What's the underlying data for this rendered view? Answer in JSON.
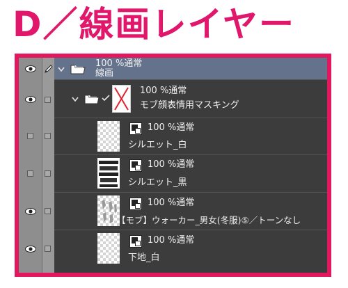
{
  "heading": "D／線画レイヤー",
  "layers": [
    {
      "opacity_blend": "100 %通常",
      "name": "線画"
    },
    {
      "opacity_blend": "100 %通常",
      "name": "モブ顔表情用マスキング"
    },
    {
      "opacity_blend": "100 %通常",
      "name": "シルエット_白"
    },
    {
      "opacity_blend": "100 %通常",
      "name": "シルエット_黒"
    },
    {
      "opacity_blend": "100 %通常",
      "name": "【モブ】ウォーカー_男女(冬服)⑤／トーンなし"
    },
    {
      "opacity_blend": "100 %通常",
      "name": "下地_白"
    }
  ],
  "colors": {
    "accent": "#e2175d",
    "heading": "#e0176a",
    "selected_row": "#64738b",
    "panel": "#3c3c3c"
  }
}
